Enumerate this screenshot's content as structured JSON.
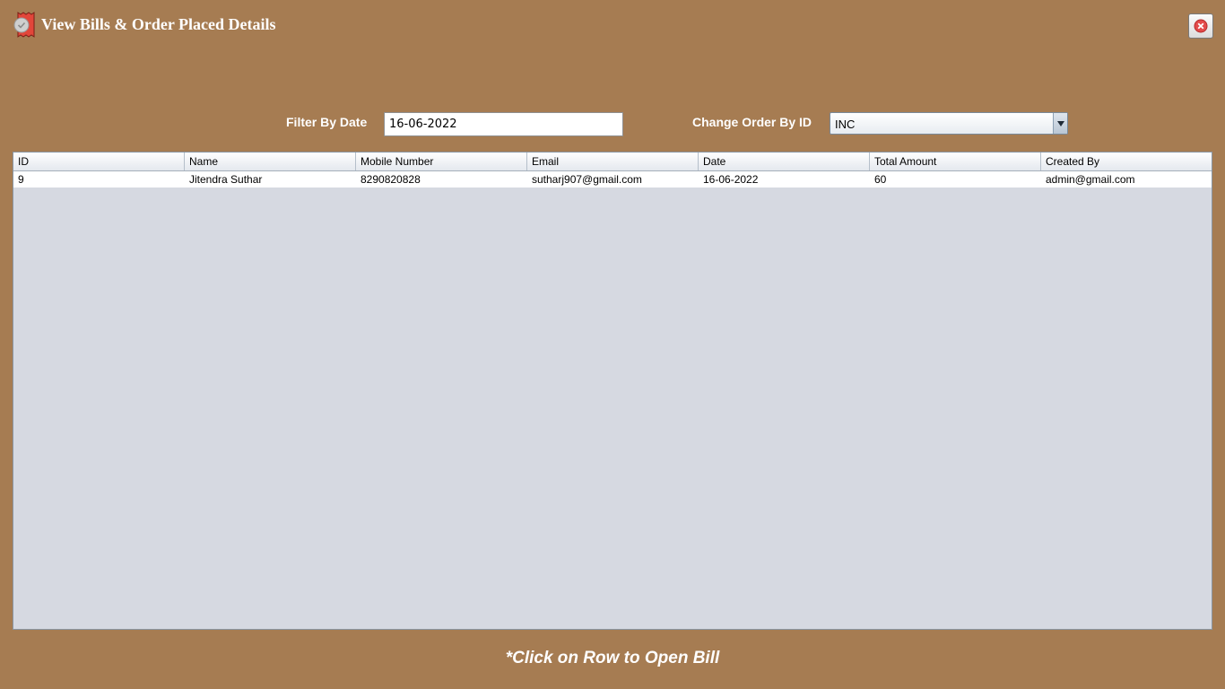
{
  "window": {
    "title": "View Bills & Order Placed Details"
  },
  "filter": {
    "date_label": "Filter By Date",
    "date_value": "16-06-2022",
    "order_label": "Change Order By ID",
    "order_value": "INC"
  },
  "table": {
    "columns": [
      "ID",
      "Name",
      "Mobile Number",
      "Email",
      "Date",
      "Total Amount",
      "Created By"
    ],
    "rows": [
      [
        "9",
        "Jitendra Suthar",
        "8290820828",
        "sutharj907@gmail.com",
        "16-06-2022",
        "60",
        "admin@gmail.com"
      ]
    ]
  },
  "footer": {
    "hint": "*Click on Row to Open Bill"
  },
  "colors": {
    "background": "#a67c52",
    "table_background": "#d6d9e1",
    "close_icon": "#e34a4a"
  },
  "icons": {
    "title": "bill-receipt-icon",
    "close": "close-icon",
    "dropdown": "chevron-down-icon"
  }
}
